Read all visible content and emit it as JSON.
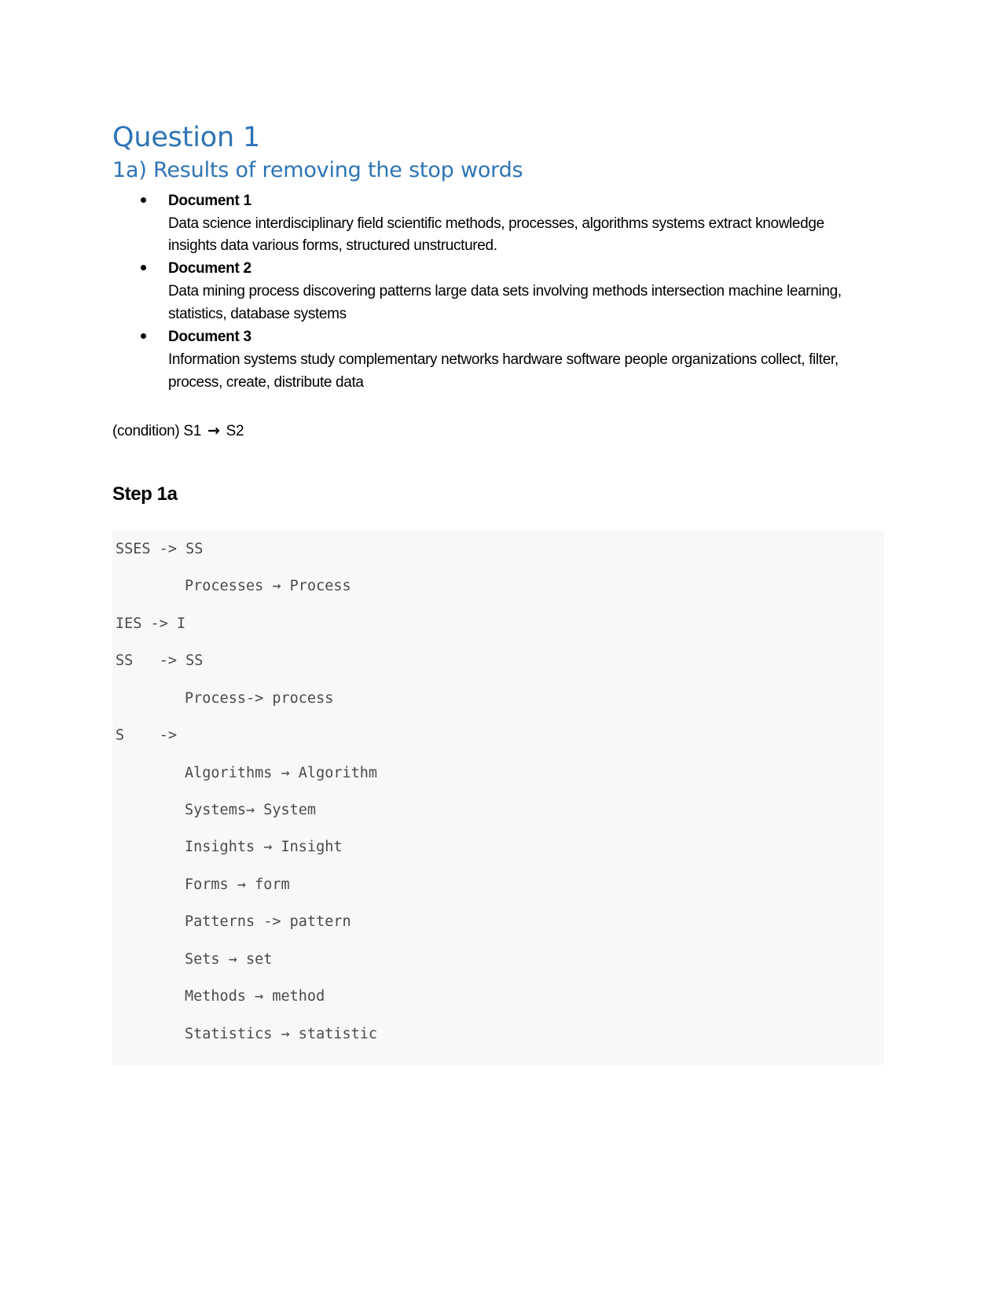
{
  "document": {
    "heading1": "Question 1",
    "heading2": "1a) Results of removing the stop words",
    "bullets": [
      {
        "label": "Document 1",
        "text": "Data science interdisciplinary field scientific methods, processes, algorithms systems extract knowledge insights data various forms, structured unstructured."
      },
      {
        "label": "Document 2",
        "text": "Data mining process discovering patterns large data sets involving methods intersection machine learning, statistics, database systems"
      },
      {
        "label": "Document 3",
        "text": "Information systems study complementary networks hardware software people organizations collect, filter, process, create, distribute data"
      }
    ],
    "condition": {
      "prefix": "(condition) S1 ",
      "arrow": "→",
      "suffix": " S2"
    },
    "step_heading": "Step 1a",
    "code_block": {
      "background_color": "#F8F8F8",
      "text_color": "#4A4A4A",
      "lines": [
        {
          "text": "SSES -> SS",
          "indent": false
        },
        {
          "text": "Processes → Process",
          "indent": true
        },
        {
          "text": "IES -> I",
          "indent": false
        },
        {
          "text": "SS   -> SS",
          "indent": false
        },
        {
          "text": "Process-> process",
          "indent": true
        },
        {
          "text": "S    ->",
          "indent": false
        },
        {
          "text": "Algorithms → Algorithm",
          "indent": true
        },
        {
          "text": "Systems→ System",
          "indent": true
        },
        {
          "text": "Insights → Insight",
          "indent": true
        },
        {
          "text": "Forms → form",
          "indent": true
        },
        {
          "text": "Patterns -> pattern",
          "indent": true
        },
        {
          "text": "Sets → set",
          "indent": true
        },
        {
          "text": "Methods → method",
          "indent": true
        },
        {
          "text": "Statistics → statistic",
          "indent": true
        }
      ]
    }
  },
  "colors": {
    "heading_blue": "#2E74B5",
    "body_black": "#000000",
    "code_gray": "#4A4A4A",
    "code_bg": "#F8F8F8",
    "page_bg": "#FFFFFF"
  }
}
